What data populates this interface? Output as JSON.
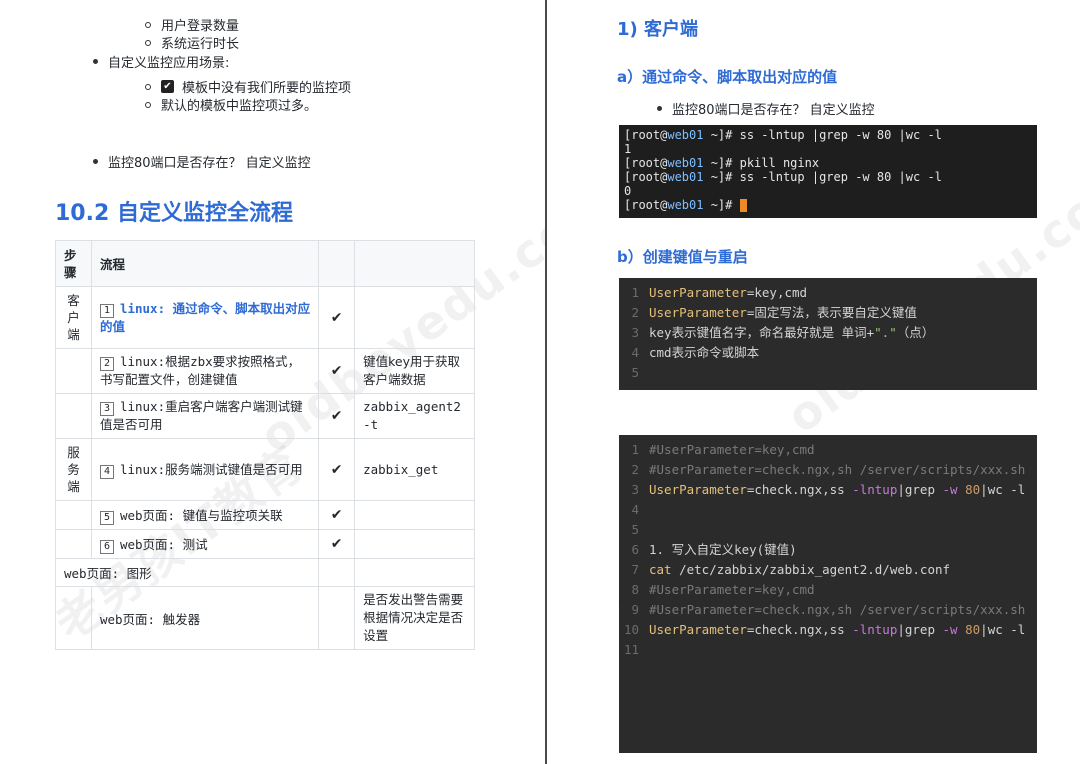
{
  "left": {
    "list": {
      "sub_items_top": [
        "用户登录数量",
        "系统运行时长"
      ],
      "scene_label": "自定义监控应用场景:",
      "scene_items": [
        "模板中没有我们所要的监控项",
        "默认的模板中监控项过多。"
      ],
      "port_check": "监控80端口是否存在？  自定义监控"
    },
    "section_title": "10.2 自定义监控全流程",
    "table": {
      "headers": [
        "步骤",
        "流程",
        "",
        ""
      ],
      "rows": [
        {
          "step": "客户端",
          "num": "1",
          "flow": "linux: 通过命令、脚本取出对应的值",
          "check": "✔",
          "note": ""
        },
        {
          "step": "",
          "num": "2",
          "flow": "linux:根据zbx要求按照格式，书写配置文件，创建键值",
          "check": "✔",
          "note": "键值key用于获取客户端数据"
        },
        {
          "step": "",
          "num": "3",
          "flow": "linux:重启客户端客户端测试键值是否可用",
          "check": "✔",
          "note": "zabbix_agent2 -t"
        },
        {
          "step": "服务端",
          "num": "4",
          "flow": "linux:服务端测试键值是否可用",
          "check": "✔",
          "note": "zabbix_get"
        },
        {
          "step": "",
          "num": "5",
          "flow": "web页面: 键值与监控项关联",
          "check": "✔",
          "note": ""
        },
        {
          "step": "",
          "num": "6",
          "flow": "web页面:  测试",
          "check": "✔",
          "note": ""
        },
        {
          "step": "",
          "num": "",
          "flow": "web页面: 图形",
          "check": "",
          "note": ""
        },
        {
          "step": "",
          "num": "",
          "flow": "web页面: 触发器",
          "check": "",
          "note": "是否发出警告需要根据情况决定是否设置"
        }
      ]
    }
  },
  "right": {
    "h1": "1)    客户端",
    "h2a": "a）通过命令、脚本取出对应的值",
    "port_check": "监控80端口是否存在？  自定义监控",
    "terminal": {
      "lines": [
        {
          "type": "prompt",
          "user": "[root@",
          "host": "web01",
          "rest": " ~]# ss -lntup |grep -w 80 |wc -l"
        },
        {
          "type": "out",
          "text": "1"
        },
        {
          "type": "prompt",
          "user": "[root@",
          "host": "web01",
          "rest": " ~]# pkill nginx"
        },
        {
          "type": "prompt",
          "user": "[root@",
          "host": "web01",
          "rest": " ~]# ss -lntup |grep -w 80 |wc -l"
        },
        {
          "type": "out",
          "text": "0"
        },
        {
          "type": "prompt",
          "user": "[root@",
          "host": "web01",
          "rest": " ~]# "
        }
      ]
    },
    "h2b": "b）创建键值与重启",
    "code1": [
      {
        "n": "1",
        "parts": [
          {
            "c": "kw",
            "t": "UserParameter"
          },
          {
            "c": "plain",
            "t": "=key,cmd"
          }
        ]
      },
      {
        "n": "2",
        "parts": [
          {
            "c": "kw",
            "t": "UserParameter"
          },
          {
            "c": "plain",
            "t": "=固定写法，表示要自定义键值"
          }
        ]
      },
      {
        "n": "3",
        "parts": [
          {
            "c": "plain",
            "t": "key表示键值名字，命名最好就是 单词+"
          },
          {
            "c": "str",
            "t": "\".\""
          },
          {
            "c": "plain",
            "t": "（点）"
          }
        ]
      },
      {
        "n": "4",
        "parts": [
          {
            "c": "plain",
            "t": "cmd表示命令或脚本"
          }
        ]
      },
      {
        "n": "5",
        "parts": []
      }
    ],
    "code2": [
      {
        "n": "1",
        "parts": [
          {
            "c": "cm",
            "t": "#UserParameter=key,cmd"
          }
        ]
      },
      {
        "n": "2",
        "parts": [
          {
            "c": "cm",
            "t": "#UserParameter=check.ngx,sh /server/scripts/xxx.sh"
          }
        ]
      },
      {
        "n": "3",
        "parts": [
          {
            "c": "kw",
            "t": "UserParameter"
          },
          {
            "c": "plain",
            "t": "=check.ngx,ss "
          },
          {
            "c": "flag",
            "t": "-lntup"
          },
          {
            "c": "plain",
            "t": "|grep "
          },
          {
            "c": "flag",
            "t": "-w"
          },
          {
            "c": "plain",
            "t": " "
          },
          {
            "c": "num",
            "t": "80"
          },
          {
            "c": "plain",
            "t": "|wc -l"
          }
        ]
      },
      {
        "n": "4",
        "parts": []
      },
      {
        "n": "5",
        "parts": []
      },
      {
        "n": "6",
        "parts": [
          {
            "c": "plain",
            "t": "1. 写入自定义key(键值)"
          }
        ]
      },
      {
        "n": "7",
        "parts": [
          {
            "c": "kw",
            "t": "cat"
          },
          {
            "c": "plain",
            "t": " /etc/zabbix/zabbix_agent2.d/web.conf"
          }
        ]
      },
      {
        "n": "8",
        "parts": [
          {
            "c": "cm",
            "t": "#UserParameter=key,cmd"
          }
        ]
      },
      {
        "n": "9",
        "parts": [
          {
            "c": "cm",
            "t": "#UserParameter=check.ngx,sh /server/scripts/xxx.sh"
          }
        ]
      },
      {
        "n": "10",
        "parts": [
          {
            "c": "kw",
            "t": "UserParameter"
          },
          {
            "c": "plain",
            "t": "=check.ngx,ss "
          },
          {
            "c": "flag",
            "t": "-lntup"
          },
          {
            "c": "plain",
            "t": "|grep "
          },
          {
            "c": "flag",
            "t": "-w"
          },
          {
            "c": "plain",
            "t": " "
          },
          {
            "c": "num",
            "t": "80"
          },
          {
            "c": "plain",
            "t": "|wc -l"
          }
        ]
      },
      {
        "n": "11",
        "parts": []
      }
    ]
  },
  "watermarks": [
    "老男孩IT教育",
    "oldboyedu.com"
  ]
}
